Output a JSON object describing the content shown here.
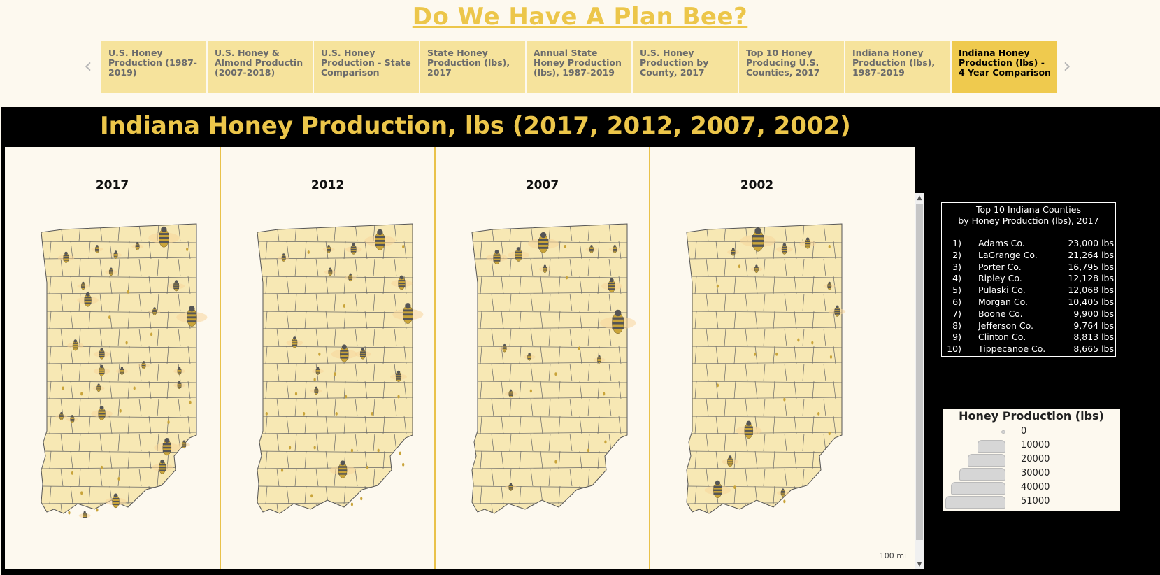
{
  "header": {
    "title": "Do We Have A Plan Bee?"
  },
  "tabs": [
    {
      "label": "U.S. Honey Production (1987-2019)",
      "active": false
    },
    {
      "label": "U.S. Honey & Almond Productin (2007-2018)",
      "active": false
    },
    {
      "label": "U.S. Honey Production - State Comparison",
      "active": false
    },
    {
      "label": "State Honey Production (lbs), 2017",
      "active": false
    },
    {
      "label": "Annual State Honey Production (lbs), 1987-2019",
      "active": false
    },
    {
      "label": "U.S. Honey Production by County, 2017",
      "active": false
    },
    {
      "label": "Top 10 Honey Producing U.S. Counties, 2017",
      "active": false
    },
    {
      "label": "Indiana Honey Production (lbs), 1987-2019",
      "active": false
    },
    {
      "label": "Indiana Honey Production (lbs) - 4 Year Comparison",
      "active": true
    }
  ],
  "nav": {
    "prev": "‹",
    "next": "›"
  },
  "dashboard": {
    "title": "Indiana Honey Production, lbs (2017, 2012, 2007, 2002)",
    "maps": [
      {
        "year": "2017",
        "bees": [
          [
            0.16,
            0.12,
            3
          ],
          [
            0.36,
            0.09,
            2
          ],
          [
            0.48,
            0.11,
            2
          ],
          [
            0.62,
            0.08,
            2
          ],
          [
            0.79,
            0.05,
            6
          ],
          [
            0.94,
            0.09,
            1
          ],
          [
            0.27,
            0.22,
            2
          ],
          [
            0.45,
            0.17,
            2
          ],
          [
            0.87,
            0.22,
            3
          ],
          [
            0.3,
            0.27,
            4
          ],
          [
            0.56,
            0.24,
            1
          ],
          [
            0.97,
            0.33,
            6
          ],
          [
            0.73,
            0.31,
            2
          ],
          [
            0.44,
            0.33,
            1
          ],
          [
            0.22,
            0.43,
            3
          ],
          [
            0.39,
            0.46,
            3
          ],
          [
            0.55,
            0.42,
            1
          ],
          [
            0.71,
            0.39,
            1
          ],
          [
            0.39,
            0.52,
            3
          ],
          [
            0.52,
            0.52,
            2
          ],
          [
            0.66,
            0.5,
            2
          ],
          [
            0.89,
            0.52,
            2
          ],
          [
            0.14,
            0.58,
            1
          ],
          [
            0.37,
            0.58,
            2
          ],
          [
            0.26,
            0.6,
            1
          ],
          [
            0.6,
            0.58,
            1
          ],
          [
            0.89,
            0.57,
            2
          ],
          [
            0.96,
            0.63,
            1
          ],
          [
            0.39,
            0.67,
            4
          ],
          [
            0.51,
            0.66,
            1
          ],
          [
            0.13,
            0.68,
            2
          ],
          [
            0.2,
            0.69,
            2
          ],
          [
            0.82,
            0.7,
            1
          ],
          [
            0.81,
            0.79,
            5
          ],
          [
            0.92,
            0.78,
            2
          ],
          [
            0.78,
            0.86,
            4
          ],
          [
            0.2,
            0.88,
            1
          ],
          [
            0.39,
            0.86,
            1
          ],
          [
            0.5,
            0.9,
            1
          ],
          [
            0.26,
            0.95,
            1
          ],
          [
            0.48,
            0.98,
            4
          ],
          [
            0.36,
            1.01,
            1
          ],
          [
            0.18,
            1.02,
            1
          ],
          [
            0.28,
            1.03,
            2
          ]
        ]
      },
      {
        "year": "2012",
        "bees": [
          [
            0.17,
            0.12,
            2
          ],
          [
            0.33,
            0.1,
            1
          ],
          [
            0.46,
            0.09,
            2
          ],
          [
            0.62,
            0.09,
            3
          ],
          [
            0.79,
            0.06,
            6
          ],
          [
            0.94,
            0.08,
            1
          ],
          [
            0.47,
            0.17,
            2
          ],
          [
            0.6,
            0.19,
            2
          ],
          [
            0.93,
            0.21,
            4
          ],
          [
            0.56,
            0.29,
            1
          ],
          [
            0.97,
            0.32,
            6
          ],
          [
            0.24,
            0.42,
            3
          ],
          [
            0.4,
            0.46,
            1
          ],
          [
            0.56,
            0.46,
            5
          ],
          [
            0.68,
            0.46,
            3
          ],
          [
            0.39,
            0.52,
            2
          ],
          [
            0.91,
            0.54,
            3
          ],
          [
            0.37,
            0.55,
            1
          ],
          [
            0.5,
            0.53,
            1
          ],
          [
            0.25,
            0.6,
            1
          ],
          [
            0.38,
            0.59,
            2
          ],
          [
            0.57,
            0.61,
            1
          ],
          [
            0.91,
            0.61,
            1
          ],
          [
            0.06,
            0.67,
            1
          ],
          [
            0.3,
            0.67,
            1
          ],
          [
            0.51,
            0.67,
            1
          ],
          [
            0.74,
            0.67,
            1
          ],
          [
            0.21,
            0.79,
            1
          ],
          [
            0.37,
            0.79,
            1
          ],
          [
            0.61,
            0.8,
            1
          ],
          [
            0.78,
            0.8,
            1
          ],
          [
            0.92,
            0.81,
            1
          ],
          [
            0.94,
            0.85,
            1
          ],
          [
            0.55,
            0.87,
            5
          ],
          [
            0.71,
            0.86,
            1
          ],
          [
            0.16,
            0.87,
            1
          ],
          [
            0.67,
            0.97,
            1
          ],
          [
            0.61,
            0.99,
            1
          ],
          [
            0.35,
            0.96,
            1
          ]
        ]
      },
      {
        "year": "2007",
        "bees": [
          [
            0.16,
            0.12,
            4
          ],
          [
            0.3,
            0.11,
            4
          ],
          [
            0.46,
            0.07,
            6
          ],
          [
            0.6,
            0.08,
            1
          ],
          [
            0.77,
            0.09,
            2
          ],
          [
            0.92,
            0.09,
            2
          ],
          [
            0.47,
            0.16,
            2
          ],
          [
            0.61,
            0.19,
            1
          ],
          [
            0.9,
            0.22,
            4
          ],
          [
            0.94,
            0.35,
            7
          ],
          [
            0.21,
            0.44,
            2
          ],
          [
            0.37,
            0.47,
            2
          ],
          [
            0.69,
            0.44,
            1
          ],
          [
            0.82,
            0.48,
            2
          ],
          [
            0.54,
            0.53,
            1
          ],
          [
            0.25,
            0.6,
            2
          ],
          [
            0.38,
            0.59,
            1
          ],
          [
            0.85,
            0.6,
            1
          ],
          [
            0.75,
            0.8,
            1
          ],
          [
            0.86,
            0.77,
            1
          ],
          [
            0.54,
            0.84,
            1
          ],
          [
            0.25,
            0.93,
            2
          ]
        ]
      },
      {
        "year": "2002",
        "bees": [
          [
            0.3,
            0.1,
            2
          ],
          [
            0.46,
            0.06,
            7
          ],
          [
            0.63,
            0.09,
            3
          ],
          [
            0.78,
            0.07,
            3
          ],
          [
            0.92,
            0.08,
            1
          ],
          [
            0.34,
            0.15,
            1
          ],
          [
            0.45,
            0.16,
            2
          ],
          [
            0.92,
            0.22,
            2
          ],
          [
            0.97,
            0.31,
            3
          ],
          [
            0.2,
            0.22,
            1
          ],
          [
            0.72,
            0.41,
            1
          ],
          [
            0.81,
            0.42,
            1
          ],
          [
            0.44,
            0.46,
            1
          ],
          [
            0.58,
            0.46,
            1
          ],
          [
            0.93,
            0.47,
            1
          ],
          [
            0.2,
            0.57,
            1
          ],
          [
            0.63,
            0.62,
            1
          ],
          [
            0.85,
            0.67,
            1
          ],
          [
            0.4,
            0.73,
            5
          ],
          [
            0.92,
            0.74,
            1
          ],
          [
            0.28,
            0.84,
            3
          ],
          [
            0.2,
            0.94,
            5
          ],
          [
            0.31,
            0.93,
            1
          ],
          [
            0.62,
            0.95,
            2
          ],
          [
            0.63,
            0.98,
            1
          ]
        ]
      }
    ],
    "scale": {
      "label": "100 mi"
    }
  },
  "top10": {
    "title_line1": "Top 10 Indiana Counties",
    "title_line2": "by Honey Production (lbs), 2017",
    "rows": [
      {
        "rank": "1)",
        "county": "Adams Co.",
        "lbs": "23,000 lbs"
      },
      {
        "rank": "2)",
        "county": "LaGrange Co.",
        "lbs": "21,264 lbs"
      },
      {
        "rank": "3)",
        "county": "Porter Co.",
        "lbs": "16,795 lbs"
      },
      {
        "rank": "4)",
        "county": "Ripley Co.",
        "lbs": "12,128 lbs"
      },
      {
        "rank": "5)",
        "county": "Pulaski Co.",
        "lbs": "12,068 lbs"
      },
      {
        "rank": "6)",
        "county": "Morgan Co.",
        "lbs": "10,405 lbs"
      },
      {
        "rank": "7)",
        "county": "Boone Co.",
        "lbs": "9,900 lbs"
      },
      {
        "rank": "8)",
        "county": "Jefferson Co.",
        "lbs": "9,764 lbs"
      },
      {
        "rank": "9)",
        "county": "Clinton Co.",
        "lbs": "8,813 lbs"
      },
      {
        "rank": "10)",
        "county": "Tippecanoe Co.",
        "lbs": "8,665 lbs"
      }
    ]
  },
  "legend": {
    "title": "Honey Production (lbs)",
    "items": [
      "0",
      "10000",
      "20000",
      "30000",
      "40000",
      "51000"
    ]
  },
  "colors": {
    "gold": "#ecc64a",
    "tab": "#f6e39c",
    "tab_active": "#efca4e",
    "county_fill": "#f7e8b4",
    "bee_body": "#c9a43a",
    "bee_stripe": "#555555"
  }
}
